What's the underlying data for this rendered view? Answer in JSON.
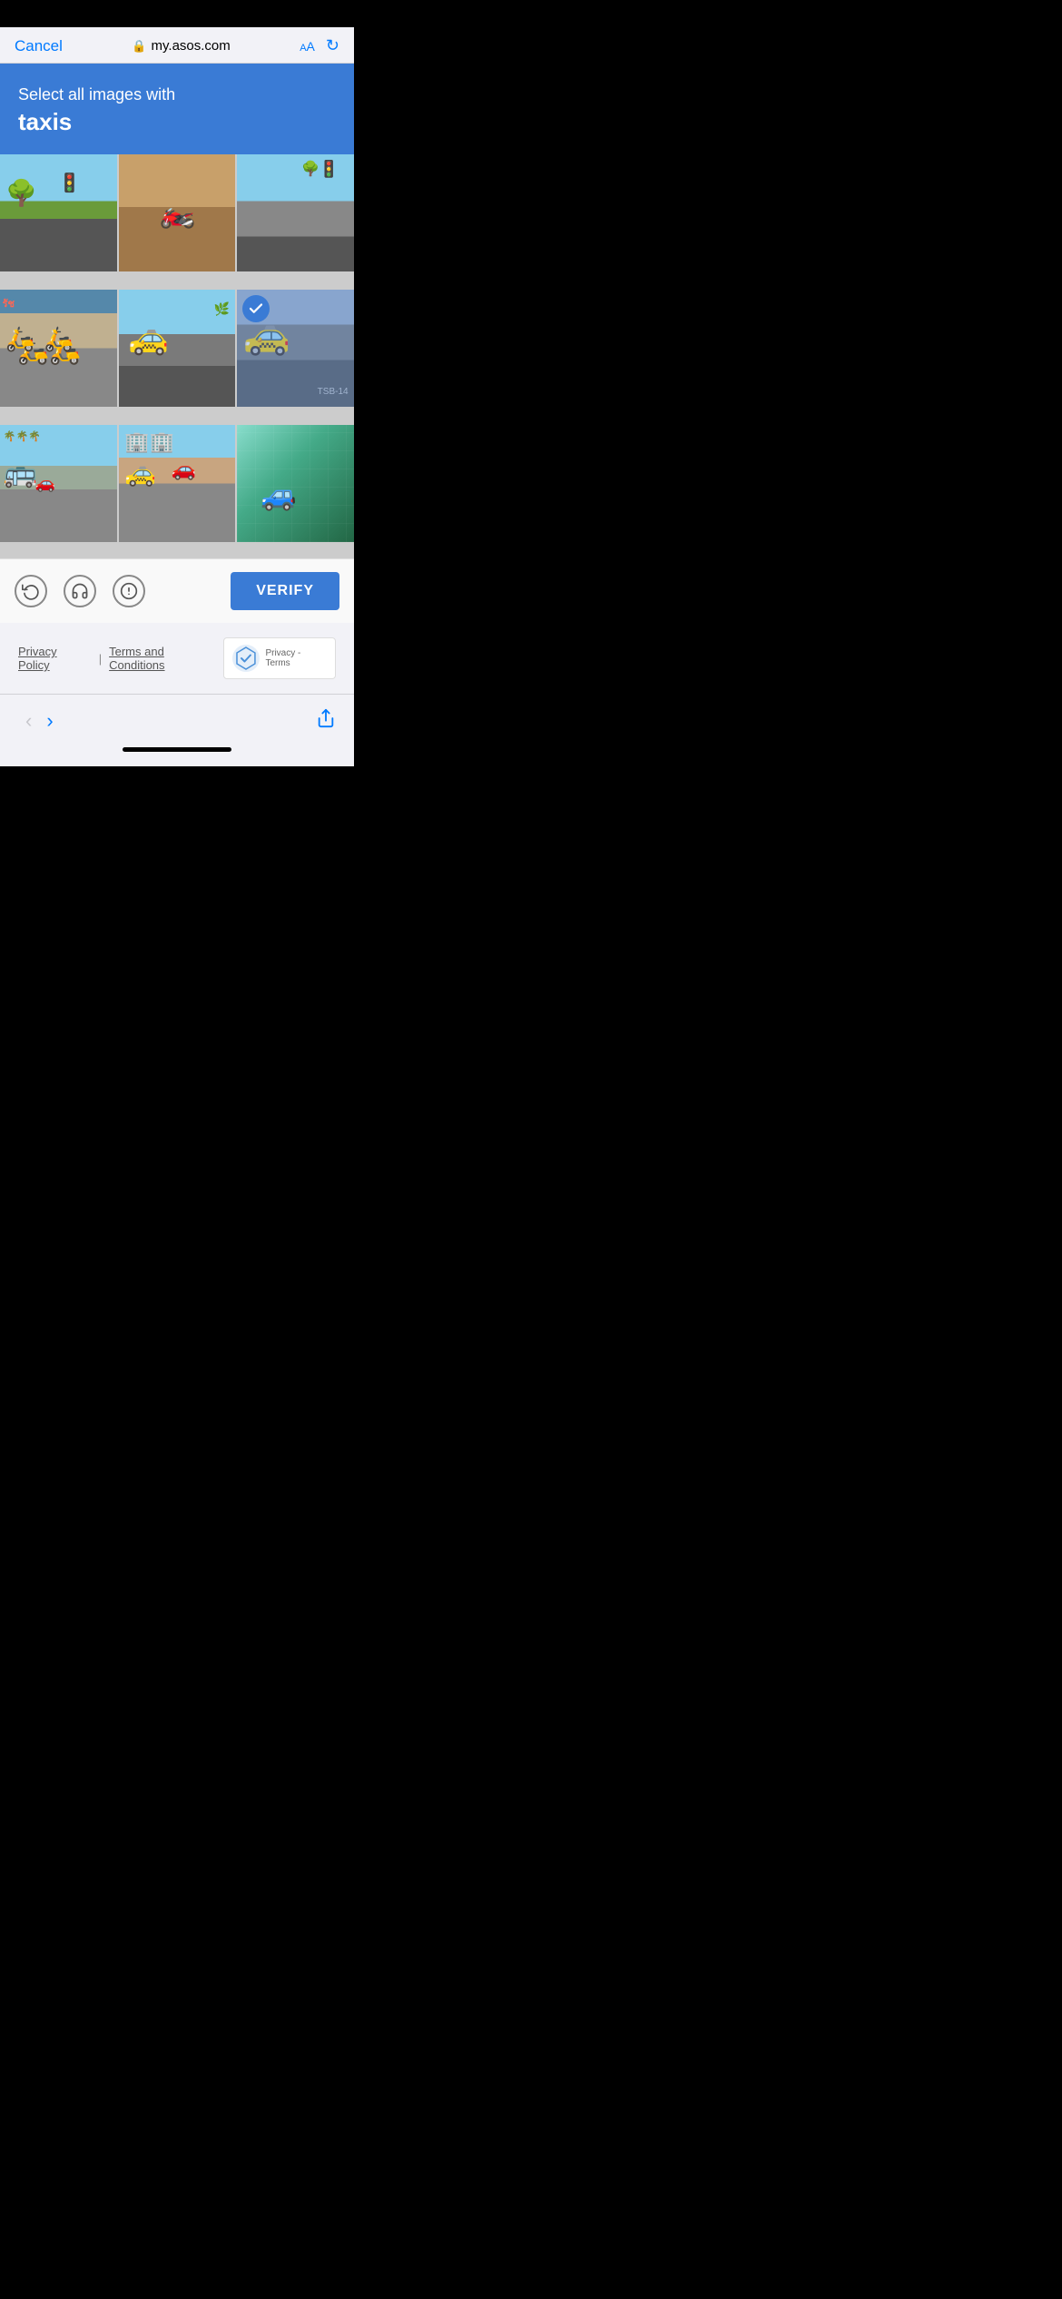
{
  "browser": {
    "cancel_label": "Cancel",
    "url": "my.asos.com",
    "lock_icon": "🔒",
    "aa_label": "AA",
    "reload_icon": "↻"
  },
  "captcha": {
    "instruction": "Select all images with",
    "target": "taxis",
    "header_bg": "#3a7bd5"
  },
  "grid": {
    "cells": [
      {
        "id": 1,
        "selected": false,
        "has_taxi": false,
        "description": "Street with traffic light and trees"
      },
      {
        "id": 2,
        "selected": false,
        "has_taxi": false,
        "description": "Person riding motorcycle on dirt road"
      },
      {
        "id": 3,
        "selected": false,
        "has_taxi": false,
        "description": "Empty intersection with road signs"
      },
      {
        "id": 4,
        "selected": false,
        "has_taxi": false,
        "description": "Motorcycles parked on street"
      },
      {
        "id": 5,
        "selected": false,
        "has_taxi": true,
        "description": "Yellow taxi car on road"
      },
      {
        "id": 6,
        "selected": true,
        "has_taxi": true,
        "description": "Yellow taxi cab close up"
      },
      {
        "id": 7,
        "selected": false,
        "has_taxi": false,
        "description": "Wide road with bus and cars"
      },
      {
        "id": 8,
        "selected": false,
        "has_taxi": true,
        "description": "City street with yellow taxi"
      },
      {
        "id": 9,
        "selected": false,
        "has_taxi": false,
        "description": "Car reflected in glass building"
      }
    ]
  },
  "toolbar": {
    "reload_label": "Reload",
    "audio_label": "Audio challenge",
    "info_label": "Help",
    "verify_label": "VERIFY"
  },
  "footer": {
    "privacy_label": "Privacy Policy",
    "terms_label": "Terms and Conditions",
    "separator": "|",
    "recaptcha_text": "Privacy - Terms"
  },
  "nav": {
    "back_label": "‹",
    "forward_label": "›",
    "share_label": "Share"
  }
}
